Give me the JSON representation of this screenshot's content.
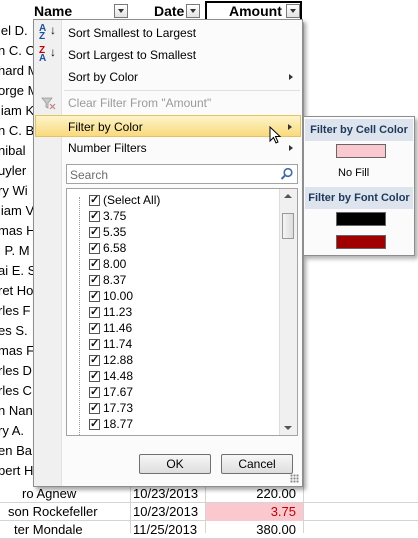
{
  "sheet": {
    "headers": {
      "name": "Name",
      "date": "Date",
      "amount": "Amount"
    },
    "left_names": [
      "iel D.",
      "n C. C",
      "hard M",
      "orge M",
      "liam K",
      "n C. B",
      "nibal",
      "uyler",
      "ry Wi",
      "liam V",
      "mas H",
      "i P. M",
      "ai E. S",
      "ret Ho",
      "rles F",
      "es S.",
      "mas F",
      "rles D",
      "rles C",
      "n Nan",
      "ry A.",
      "en Ba",
      "bert H"
    ],
    "visible_rows": [
      {
        "name": "ro Agnew",
        "date": "10/23/2013",
        "amount": "220.00",
        "highlight": false
      },
      {
        "name": "son Rockefeller",
        "date": "10/23/2013",
        "amount": "3.75",
        "highlight": true
      },
      {
        "name": "ter Mondale",
        "date": "11/25/2013",
        "amount": "380.00",
        "highlight": false
      }
    ],
    "highlight_fill": "#f9c9cf",
    "highlight_text": "#c00000"
  },
  "menu": {
    "sort_asc": "Sort Smallest to Largest",
    "sort_desc": "Sort Largest to Smallest",
    "sort_color": "Sort by Color",
    "clear_filter": "Clear Filter From \"Amount\"",
    "filter_color": "Filter by Color",
    "number_filters": "Number Filters",
    "search_placeholder": "Search",
    "list": [
      "(Select All)",
      "3.75",
      "5.35",
      "6.58",
      "8.00",
      "8.37",
      "10.00",
      "11.23",
      "11.46",
      "11.74",
      "12.88",
      "14.48",
      "17.67",
      "17.73",
      "18.77"
    ],
    "ok": "OK",
    "cancel": "Cancel",
    "icon_az_top": "A",
    "icon_az_bottom": "Z",
    "icon_za_top": "Z",
    "icon_za_bottom": "A"
  },
  "submenu": {
    "cell_color_header": "Filter by Cell Color",
    "no_fill": "No Fill",
    "font_color_header": "Filter by Font Color",
    "cell_colors": [
      "#f9c9cf"
    ],
    "font_colors": [
      "#000000",
      "#a00000"
    ]
  }
}
